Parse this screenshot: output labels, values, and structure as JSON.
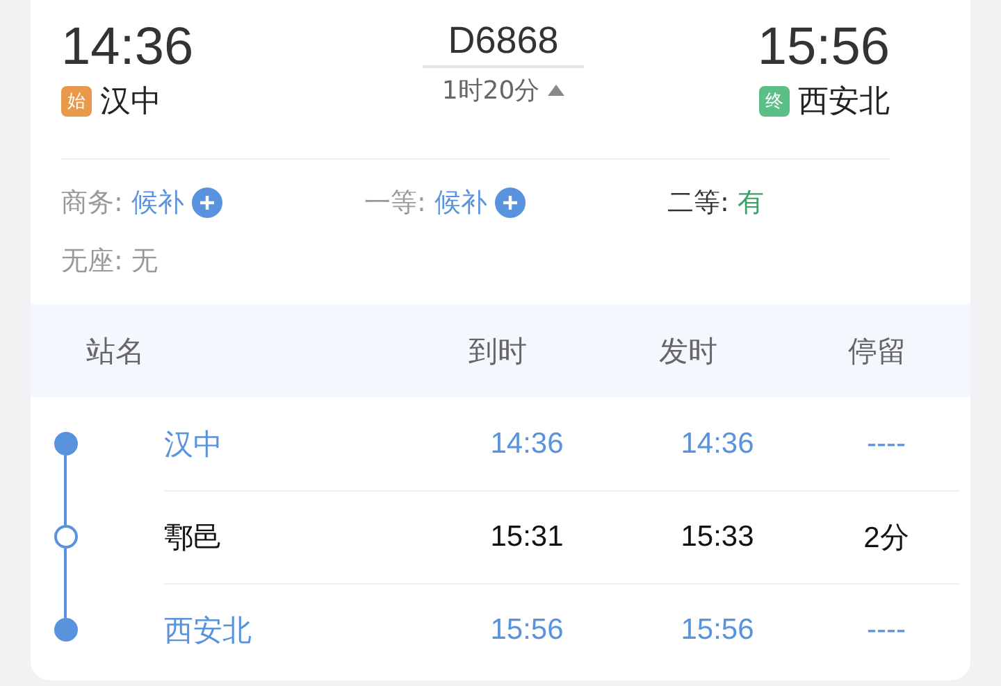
{
  "train": {
    "number": "D6868",
    "duration": "1时20分",
    "expanded": true
  },
  "departure": {
    "time": "14:36",
    "badge": "始",
    "station": "汉中"
  },
  "arrival": {
    "time": "15:56",
    "badge": "终",
    "station": "西安北"
  },
  "seats": [
    {
      "label": "商务:",
      "value": "候补",
      "kind": "waitlist"
    },
    {
      "label": "一等:",
      "value": "候补",
      "kind": "waitlist"
    },
    {
      "label": "二等:",
      "value": "有",
      "kind": "available"
    },
    {
      "label": "无座:",
      "value": "无",
      "kind": "none"
    }
  ],
  "table": {
    "columns": [
      "站名",
      "到时",
      "发时",
      "停留"
    ],
    "rows": [
      {
        "kind": "terminal",
        "station": "汉中",
        "arrive": "14:36",
        "depart": "14:36",
        "stay": "----"
      },
      {
        "kind": "stop",
        "station": "鄠邑",
        "arrive": "15:31",
        "depart": "15:33",
        "stay": "2分"
      },
      {
        "kind": "terminal",
        "station": "西安北",
        "arrive": "15:56",
        "depart": "15:56",
        "stay": "----"
      }
    ]
  }
}
